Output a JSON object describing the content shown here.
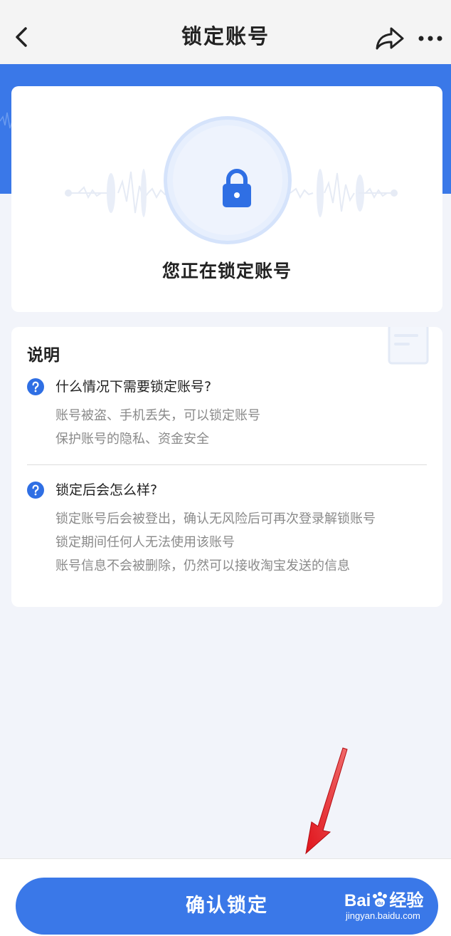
{
  "header": {
    "title": "锁定账号",
    "back_icon": "chevron-left-icon",
    "share_icon": "share-icon",
    "more_icon": "more-icon"
  },
  "hero": {
    "status_text": "您正在锁定账号",
    "icon": "lock-icon"
  },
  "info": {
    "title": "说明",
    "items": [
      {
        "question": "什么情况下需要锁定账号?",
        "answers": [
          "账号被盗、手机丢失，可以锁定账号",
          "保护账号的隐私、资金安全"
        ]
      },
      {
        "question": "锁定后会怎么样?",
        "answers": [
          "锁定账号后会被登出，确认无风险后可再次登录解锁账号",
          "锁定期间任何人无法使用该账号",
          "账号信息不会被删除，仍然可以接收淘宝发送的信息"
        ]
      }
    ]
  },
  "footer": {
    "confirm_label": "确认锁定"
  },
  "watermark": {
    "logo_left": "Bai",
    "logo_right": "经验",
    "site": "jingyan.baidu.com"
  },
  "colors": {
    "primary": "#3a78e8",
    "background": "#f2f4fa",
    "annotation_arrow": "#e0141c"
  }
}
